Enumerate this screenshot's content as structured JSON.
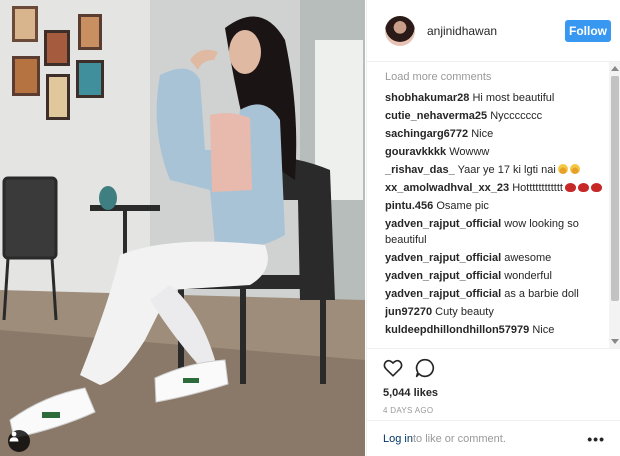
{
  "post": {
    "username": "anjinidhawan",
    "follow_label": "Follow"
  },
  "comments": {
    "load_more": "Load more comments",
    "items": [
      {
        "user": "shobhakumar28",
        "text": "Hi most beautiful",
        "emoji": []
      },
      {
        "user": "cutie_nehaverma25",
        "text": "Nyccccccc",
        "emoji": []
      },
      {
        "user": "sachingarg6772",
        "text": "Nice",
        "emoji": []
      },
      {
        "user": "gouravkkkk",
        "text": "Wowww",
        "emoji": []
      },
      {
        "user": "_rishav_das_",
        "text": "Yaar ye 17 ki lgti nai",
        "emoji": [
          "face",
          "face"
        ]
      },
      {
        "user": "xx_amolwadhval_xx_23",
        "text": "Hotttttttttttt",
        "emoji": [
          "lips",
          "lips",
          "lips"
        ]
      },
      {
        "user": "pintu.456",
        "text": "Osame pic",
        "emoji": []
      },
      {
        "user": "yadven_rajput_official",
        "text": "wow looking so beautiful",
        "emoji": []
      },
      {
        "user": "yadven_rajput_official",
        "text": "awesome",
        "emoji": []
      },
      {
        "user": "yadven_rajput_official",
        "text": "wonderful",
        "emoji": []
      },
      {
        "user": "yadven_rajput_official",
        "text": "as a barbie doll",
        "emoji": []
      },
      {
        "user": "jun97270",
        "text": "Cuty beauty",
        "emoji": []
      },
      {
        "user": "kuldeepdhillondhillon57979",
        "text": "Nice",
        "emoji": []
      }
    ]
  },
  "actions": {
    "like_icon": "heart-outline-icon",
    "comment_icon": "speech-bubble-icon"
  },
  "likes": "5,044 likes",
  "timestamp": "4 DAYS AGO",
  "footer": {
    "login_label": "Log in",
    "suffix": " to like or comment.",
    "more_label": "•••"
  },
  "colors": {
    "follow_button": "#3897f0",
    "muted_text": "#999999",
    "link": "#003569"
  }
}
